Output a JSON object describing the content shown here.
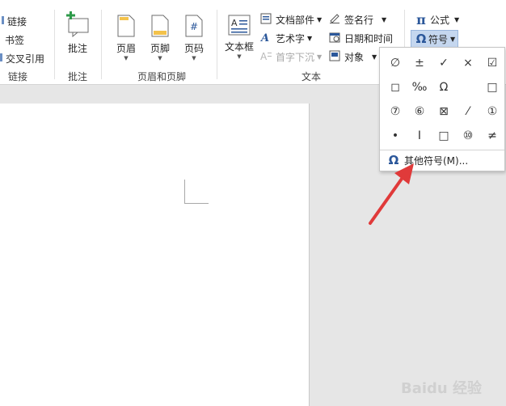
{
  "links_group": {
    "items": [
      "链接",
      "书签",
      "交叉引用"
    ],
    "label": "链接"
  },
  "comment_group": {
    "button_label": "批注",
    "label": "批注"
  },
  "header_footer_group": {
    "header_label": "页眉",
    "footer_label": "页脚",
    "page_number_label": "页码",
    "label": "页眉和页脚"
  },
  "text_group": {
    "textbox_label": "文本框",
    "doc_parts_label": "文档部件",
    "wordart_label": "艺术字",
    "dropcap_label": "首字下沉",
    "signature_label": "签名行",
    "datetime_label": "日期和时间",
    "object_label": "对象",
    "label": "文本"
  },
  "symbols_group": {
    "formula_label": "公式",
    "formula_icon": "π",
    "symbol_label": "符号",
    "symbol_icon": "Ω"
  },
  "symbol_panel": {
    "symbols": [
      "∅",
      "±",
      "✓",
      "×",
      "☑",
      "◻",
      "‰",
      "Ω",
      "",
      "□",
      "⑦",
      "⑥",
      "⊠",
      "⁄",
      "①",
      "•",
      "I",
      "□",
      "⑩",
      "≠"
    ],
    "more_label": "其他符号(M)...",
    "more_icon": "Ω"
  },
  "watermark": "Baidu 经验"
}
